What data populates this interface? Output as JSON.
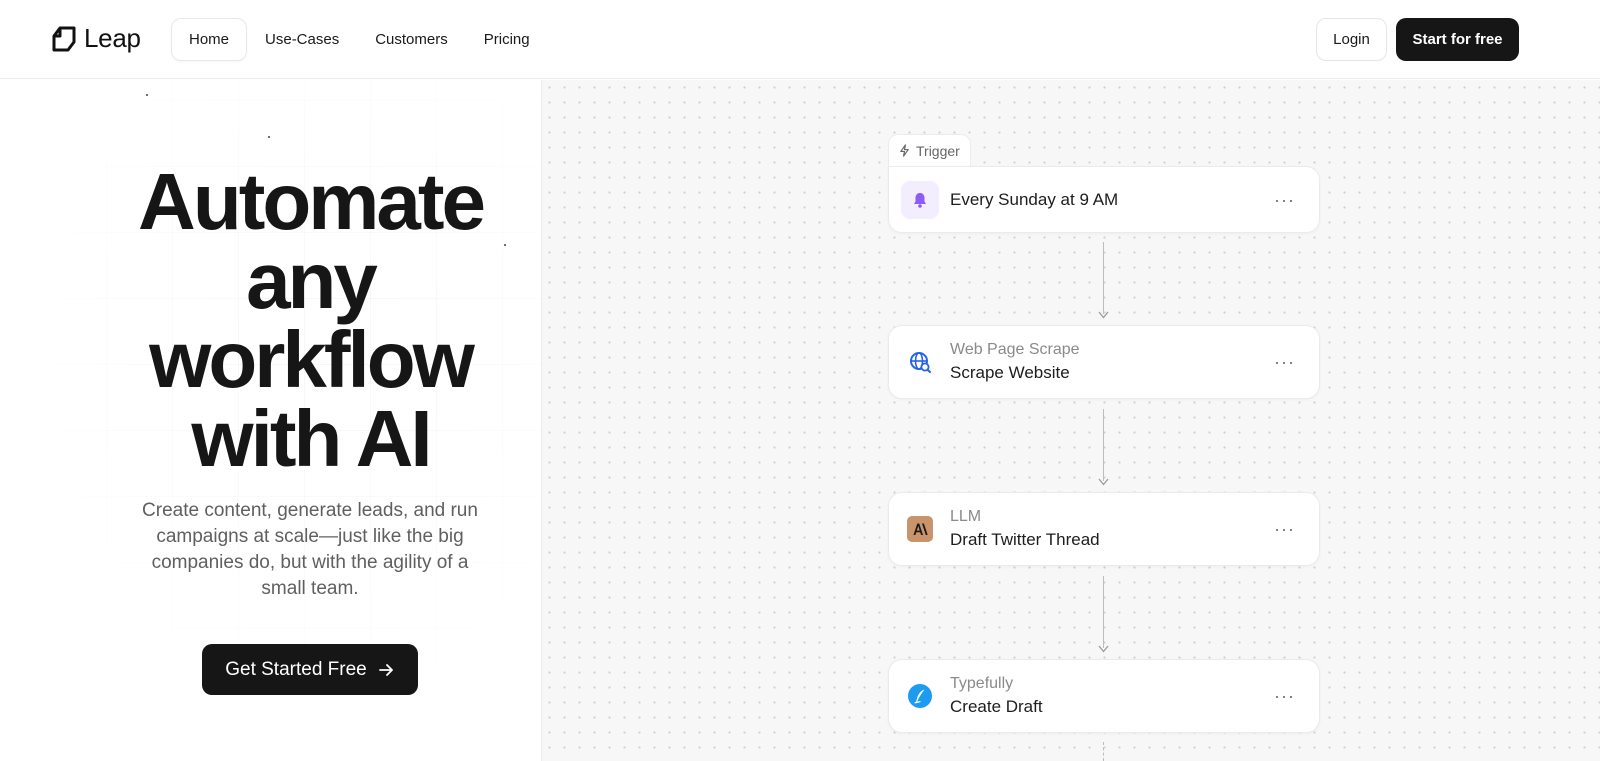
{
  "header": {
    "brand": "Leap",
    "nav": [
      {
        "label": "Home",
        "active": true
      },
      {
        "label": "Use-Cases",
        "active": false
      },
      {
        "label": "Customers",
        "active": false
      },
      {
        "label": "Pricing",
        "active": false
      }
    ],
    "login_label": "Login",
    "start_label": "Start for free"
  },
  "hero": {
    "headline_lines": [
      "Automate",
      "any",
      "workflow",
      "with AI"
    ],
    "subhead": "Create content, generate leads, and run campaigns at scale—just like the big companies do, but with the agility of a small team.",
    "cta_label": "Get Started Free"
  },
  "workflow": {
    "trigger_tab": "Trigger",
    "nodes": [
      {
        "type": "",
        "title": "Every Sunday at 9 AM",
        "icon": "bell-icon",
        "accent": "#8b5cf6"
      },
      {
        "type": "Web Page Scrape",
        "title": "Scrape Website",
        "icon": "globe-search-icon",
        "accent": "#2563eb"
      },
      {
        "type": "LLM",
        "title": "Draft Twitter Thread",
        "icon": "anthropic-icon",
        "accent": "#c9946a"
      },
      {
        "type": "Typefully",
        "title": "Create Draft",
        "icon": "typefully-icon",
        "accent": "#1d9bf0"
      }
    ],
    "menu_glyph": "···"
  },
  "colors": {
    "primary_dark": "#161616",
    "canvas_bg": "#f7f7f7",
    "muted_text": "#5f5f5f"
  }
}
